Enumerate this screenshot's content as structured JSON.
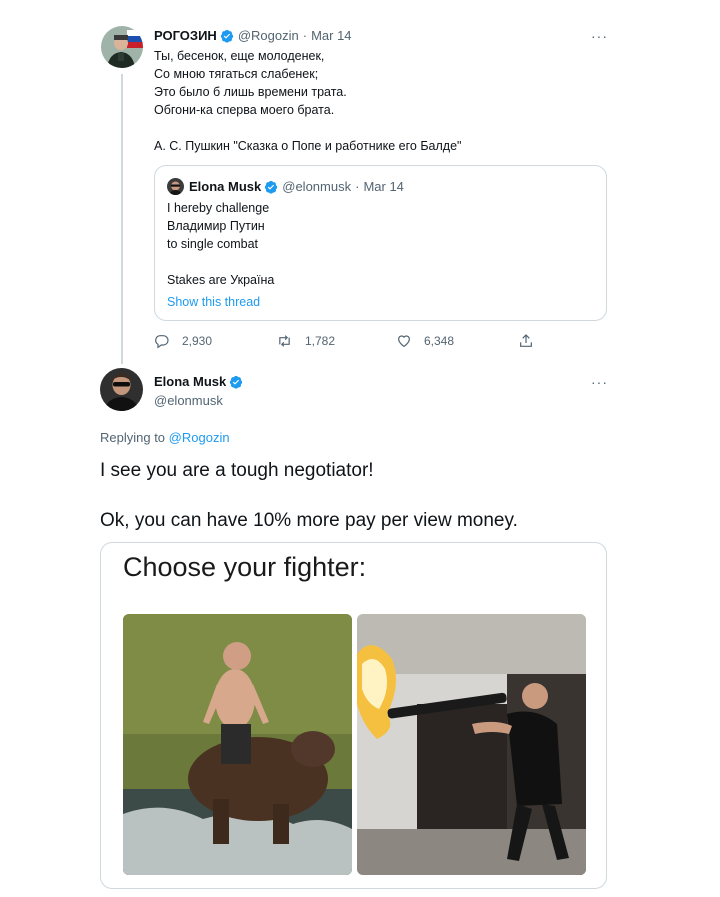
{
  "tweet1": {
    "name": "РОГОЗИН",
    "handle": "@Rogozin",
    "date": "Mar 14",
    "poem": [
      "Ты, бесенок, еще молоденек,",
      "Со мною тягаться слабенек;",
      "Это было б лишь времени трата.",
      "Обгони-ка сперва моего брата."
    ],
    "attribution": "А. С. Пушкин \"Сказка о Попе и работнике его Балде\"",
    "quote": {
      "name": "Elona Musk",
      "handle": "@elonmusk",
      "date": "Mar 14",
      "lines": [
        "I hereby challenge",
        "Владимир Путин",
        "to single combat"
      ],
      "stakes": "Stakes are Україна",
      "show_thread": "Show this thread"
    },
    "actions": {
      "replies": "2,930",
      "retweets": "1,782",
      "likes": "6,348"
    }
  },
  "tweet2": {
    "name": "Elona Musk",
    "handle": "@elonmusk",
    "replying_prefix": "Replying to",
    "replying_to": "@Rogozin",
    "text_line1": "I see you are a tough negotiator!",
    "text_line2": "Ok, you can have 10% more pay per view money.",
    "meme_title": "Choose your fighter:"
  },
  "more_label": "···",
  "colors": {
    "accent": "#1d9bf0",
    "secondary_text": "#536471",
    "border": "#cfd9de"
  },
  "icons": {
    "verified": "verified-badge-icon",
    "reply": "reply-icon",
    "retweet": "retweet-icon",
    "like": "heart-icon",
    "share": "share-icon",
    "more": "more-dots-icon"
  }
}
